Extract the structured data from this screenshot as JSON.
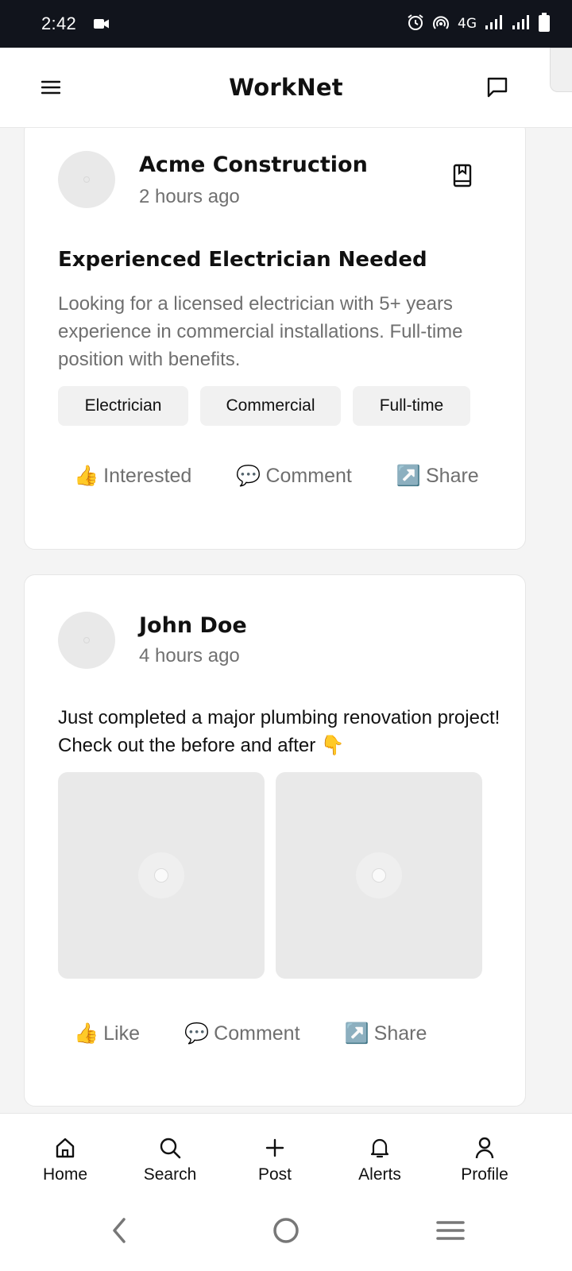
{
  "status_bar": {
    "time": "2:42",
    "network": "4G",
    "icons": [
      "video-camera-icon",
      "alarm-icon",
      "hotspot-icon",
      "signal-icon",
      "battery-icon"
    ]
  },
  "header": {
    "title": "WorkNet",
    "menu_icon": "hamburger-icon",
    "messages_icon": "chat-icon"
  },
  "posts": [
    {
      "author": "Acme Construction",
      "time": "2 hours ago",
      "title": "Experienced Electrician Needed",
      "description": "Looking for a licensed electrician with 5+ years experience in commercial installations. Full-time position with benefits.",
      "tags": [
        "Electrician",
        "Commercial",
        "Full-time"
      ],
      "actions": [
        {
          "emoji": "👍",
          "label": "Interested"
        },
        {
          "emoji": "💬",
          "label": "Comment"
        },
        {
          "emoji": "↗️",
          "label": "Share"
        }
      ]
    },
    {
      "author": "John Doe",
      "time": "4 hours ago",
      "text": "Just completed a major plumbing renovation project! Check out the before and after 👇",
      "photos": 2,
      "actions": [
        {
          "emoji": "👍",
          "label": "Like"
        },
        {
          "emoji": "💬",
          "label": "Comment"
        },
        {
          "emoji": "↗️",
          "label": "Share"
        }
      ]
    }
  ],
  "bottom_nav": [
    {
      "icon": "home-icon",
      "label": "Home"
    },
    {
      "icon": "search-icon",
      "label": "Search"
    },
    {
      "icon": "plus-icon",
      "label": "Post"
    },
    {
      "icon": "bell-icon",
      "label": "Alerts"
    },
    {
      "icon": "person-icon",
      "label": "Profile"
    }
  ],
  "system_nav": [
    "back-icon",
    "home-circle-icon",
    "recents-icon"
  ]
}
